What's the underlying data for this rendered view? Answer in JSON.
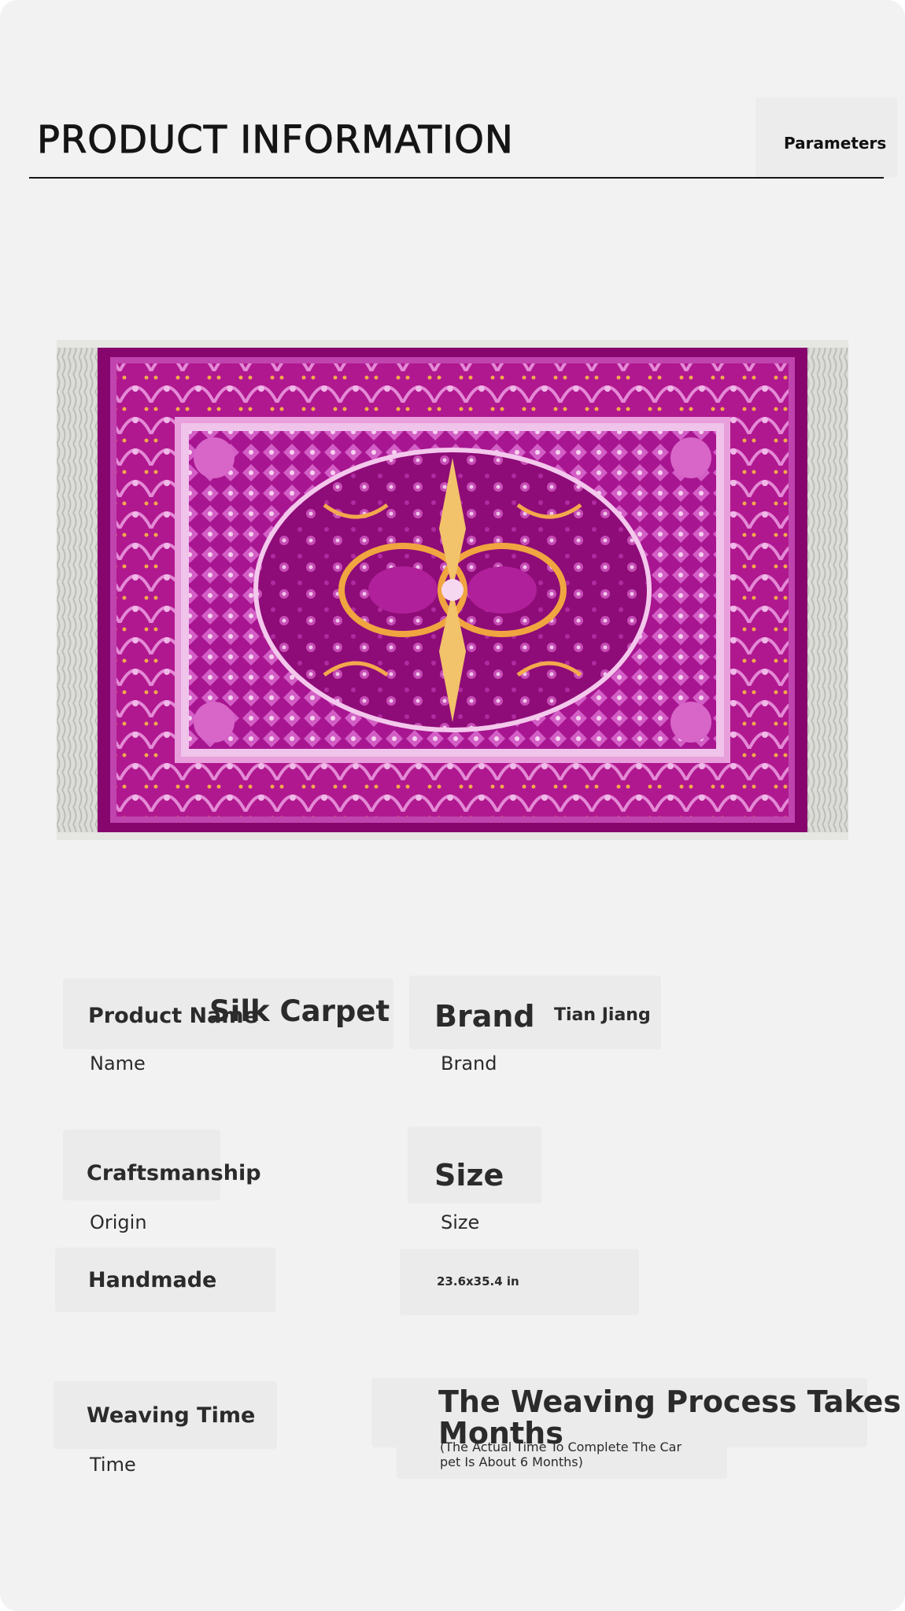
{
  "header": {
    "title": "PRODUCT INFORMATION",
    "tab_label": "Parameters"
  },
  "product_image": {
    "alt": "pink-purple floral silk carpet",
    "colors": {
      "field": "#9a0b7e",
      "accent_gold": "#e4a13e",
      "fringe": "#d9d9d6"
    }
  },
  "specs": {
    "product_name": {
      "label": "Product Name",
      "value": "Silk Carpet",
      "sub_label": "Name"
    },
    "brand": {
      "label": "Brand",
      "value": "Tian Jiang",
      "sub_label": "Brand"
    },
    "craftsmanship": {
      "label": "Craftsmanship",
      "sub_label": "Origin",
      "value": "Handmade"
    },
    "size": {
      "label": "Size",
      "sub_label": "Size",
      "value": "23.6x35.4 in"
    },
    "weaving_time": {
      "label": "Weaving Time",
      "sub_label": "Time",
      "value_line1": "The Weaving Process Takes Abo",
      "value_line2": "Months",
      "note_line1": "(The Actual Time To Complete The Car",
      "note_line2": "pet Is About 6 Months)"
    }
  }
}
